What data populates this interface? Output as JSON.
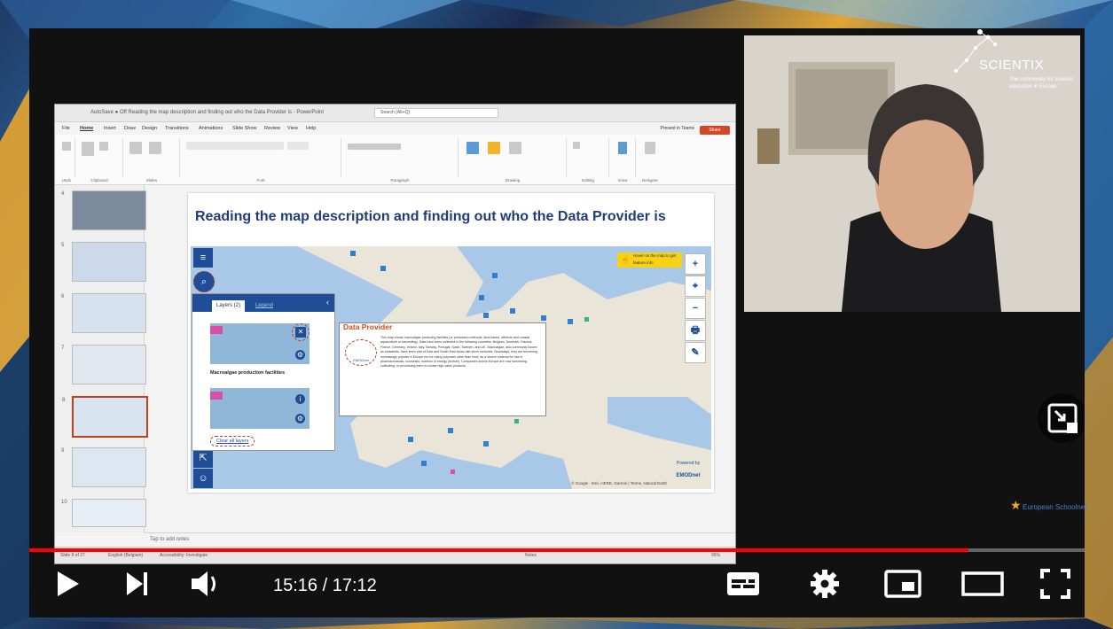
{
  "player": {
    "time_current": "15:16",
    "time_total": "17:12",
    "progress": 0.89,
    "colors": {
      "progress": "#ff0000",
      "control": "#ffffff"
    },
    "icons": [
      "play-icon",
      "next-icon",
      "volume-icon",
      "subtitles-icon",
      "settings-icon",
      "miniplayer-icon",
      "theater-icon",
      "fullscreen-icon",
      "minimize-player-icon"
    ]
  },
  "branding": {
    "scientix": "SCIENTIX",
    "scientix_tagline": "The community for science education in Europe",
    "european_schoolnet": "European Schoolnet"
  },
  "powerpoint": {
    "title_bar": "AutoSave  ● Off   Reading the map description and finding out who the Data Provider is - PowerPoint",
    "search_placeholder": "Search (Alt+Q)",
    "tabs": [
      "File",
      "Home",
      "Insert",
      "Draw",
      "Design",
      "Transitions",
      "Animations",
      "Slide Show",
      "Review",
      "View",
      "Help"
    ],
    "present_label": "Present in Teams",
    "share_label": "Share",
    "ribbon_groups": [
      "Undo",
      "Clipboard",
      "Slides",
      "Font",
      "Paragraph",
      "Drawing",
      "Editing",
      "Voice",
      "Designer"
    ],
    "thumbnail_numbers": [
      "4",
      "5",
      "6",
      "7",
      "8",
      "9",
      "10"
    ],
    "selected_slide": 8,
    "notes_placeholder": "Tap to add notes",
    "status": {
      "slide_count": "Slide 8 of 27",
      "language": "English (Belgium)",
      "accessibility": "Accessibility: Investigate",
      "notes": "Notes",
      "zoom": "95%"
    }
  },
  "slide": {
    "title": "Reading the map description and finding out who the Data Provider is",
    "map": {
      "hover_tip": "Hover on the map to get feature info",
      "controls": [
        "+",
        "⌖",
        "−",
        "🖶",
        "✎"
      ],
      "layer_panel": {
        "tab_layers": "Layers (2)",
        "tab_legend": "Legend",
        "layer_name": "Macroalgae production facilities",
        "clear_all": "Clear all layers"
      },
      "data_provider": {
        "title": "Data Provider",
        "logo_text": "EMODnet",
        "description": "This map shows macroalgae producing facilities (or production methods: land-based, offshore and coastal aquaculture or harvesting). Data have been collected in the following countries: Belgium, Denmark, Estonia, France, Germany, Ireland, Italy, Norway, Portugal, Spain, Sweden, and UK. Macroalgae, also commonly known as seaweeds, have been part of East and South-East Asian diet since centuries. Nowadays, they are becoming increasingly popular in Europe too for many purposes other than food, as a source material for use in pharmaceuticals, cosmetics, nutrition or energy (biofuel). Companies across Europe are now harvesting, cultivating, or processing them to create high-value products."
      },
      "powered_by": "Powered by",
      "powered_logo": "EMODnet",
      "attribution": "© Google · Esri, HERE, Garmin | Terms, Natural Earth"
    }
  }
}
